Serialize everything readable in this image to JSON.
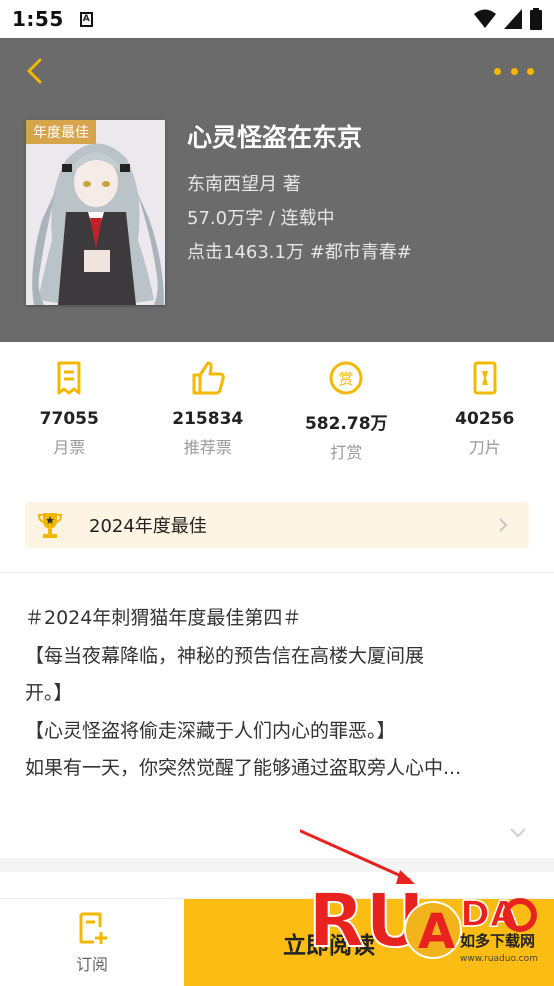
{
  "status_bar": {
    "time": "1:55",
    "notification": "A"
  },
  "header": {
    "title": "心灵怪盗在东京",
    "author": "东南西望月 著",
    "words": "57.0万字 / 连载中",
    "clicks": "点击1463.1万 #都市青春#",
    "cover_badge": "年度最佳",
    "icons": {
      "back": "back-arrow-icon",
      "more": "more-dots-icon"
    },
    "accent": "#f5b800"
  },
  "stats": [
    {
      "value": "77055",
      "label": "月票",
      "icon": "ticket-icon"
    },
    {
      "value": "215834",
      "label": "推荐票",
      "icon": "thumbs-up-icon"
    },
    {
      "value": "582.78万",
      "label": "打赏",
      "icon": "reward-coin-icon"
    },
    {
      "value": "40256",
      "label": "刀片",
      "icon": "blade-icon"
    }
  ],
  "award": {
    "label": "2024年度最佳",
    "icon": "trophy-icon"
  },
  "description": {
    "lines": [
      "＃2024年刺猬猫年度最佳第四＃",
      "【每当夜幕降临，神秘的预告信在高楼大厦间展",
      "开。】",
      "【心灵怪盗将偷走深藏于人们内心的罪恶。】",
      "如果有一天，你突然觉醒了能够通过盗取旁人心中..."
    ]
  },
  "bottom": {
    "subscribe_label": "订阅",
    "read_label": "立即阅读"
  },
  "watermark": {
    "brand": "RUANDAO",
    "site_cn": "如多下载网",
    "url": "www.ruaduo.com"
  },
  "colors": {
    "header_bg": "#6b6b6b",
    "accent": "#fbbd13",
    "award_bg": "#fdf4e3"
  }
}
